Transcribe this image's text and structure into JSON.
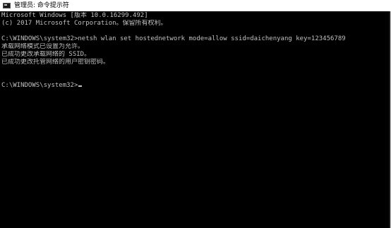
{
  "window": {
    "title": "管理员: 命令提示符"
  },
  "console": {
    "lines": [
      "Microsoft Windows [版本 10.0.16299.492]",
      "(c) 2017 Microsoft Corporation。保留所有权利。",
      "",
      "C:\\WINDOWS\\system32>netsh wlan set hostednetwork mode=allow ssid=daichenyang key=123456789",
      "承载网络模式已设置为允许。",
      "已成功更改承载网络的 SSID。",
      "已成功更改托管网络的用户密钥密码。",
      "",
      "",
      "C:\\WINDOWS\\system32>"
    ]
  }
}
